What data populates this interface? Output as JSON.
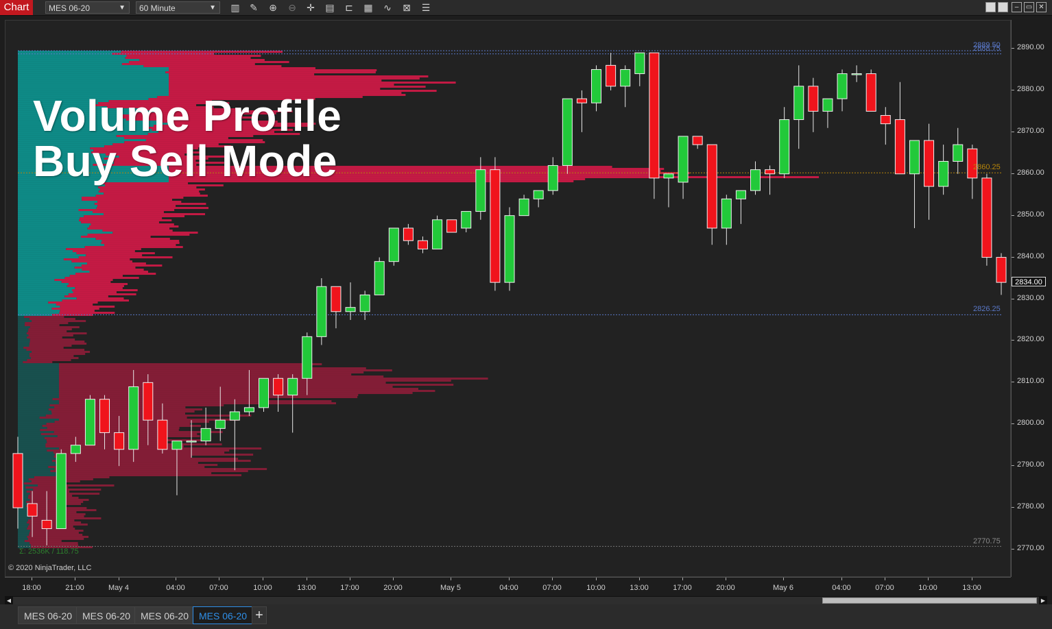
{
  "window": {
    "chart_label": "Chart",
    "instrument": "MES 06-20",
    "interval": "60 Minute"
  },
  "headline": {
    "line1": "Volume Profile",
    "line2": "Buy Sell Mode"
  },
  "copyright": "© 2020 NinjaTrader, LLC",
  "stats": "Σ: 2536K / 118.75",
  "price_axis": {
    "labels": [
      "2890.00",
      "2880.00",
      "2870.00",
      "2860.00",
      "2850.00",
      "2840.00",
      "2830.00",
      "2820.00",
      "2810.00",
      "2800.00",
      "2790.00",
      "2780.00",
      "2770.00"
    ],
    "last_price": "2834.00"
  },
  "levels": {
    "high_a": "2889.50",
    "high_b": "2888.75",
    "poc": "2860.25",
    "value_low": "2826.25",
    "low": "2770.75"
  },
  "time_axis": {
    "labels": [
      "18:00",
      "21:00",
      "May 4",
      "04:00",
      "07:00",
      "10:00",
      "13:00",
      "17:00",
      "20:00",
      "May 5",
      "04:00",
      "07:00",
      "10:00",
      "13:00",
      "17:00",
      "20:00",
      "May 6",
      "04:00",
      "07:00",
      "10:00",
      "13:00"
    ]
  },
  "tabs": [
    "MES 06-20",
    "MES 06-20",
    "MES 06-20",
    "MES 06-20"
  ],
  "active_tab": 3,
  "colors": {
    "up": "#22c93a",
    "down": "#f0141c",
    "buy_volume": "#0e8a86",
    "sell_volume": "#c41a44",
    "accent": "#2f8fe8"
  },
  "chart_data": {
    "type": "candlestick",
    "title": "",
    "xlabel": "",
    "ylabel": "",
    "ylim": [
      2766,
      2896
    ],
    "candles": [
      {
        "o": 2793,
        "h": 2797,
        "l": 2775,
        "c": 2780
      },
      {
        "o": 2781,
        "h": 2784,
        "l": 2773,
        "c": 2778
      },
      {
        "o": 2777,
        "h": 2784,
        "l": 2771,
        "c": 2775
      },
      {
        "o": 2775,
        "h": 2794,
        "l": 2775,
        "c": 2793
      },
      {
        "o": 2793,
        "h": 2797,
        "l": 2791,
        "c": 2795
      },
      {
        "o": 2795,
        "h": 2807,
        "l": 2795,
        "c": 2806
      },
      {
        "o": 2806,
        "h": 2807,
        "l": 2794,
        "c": 2798
      },
      {
        "o": 2798,
        "h": 2802,
        "l": 2790,
        "c": 2794
      },
      {
        "o": 2794,
        "h": 2813,
        "l": 2791,
        "c": 2809
      },
      {
        "o": 2810,
        "h": 2812,
        "l": 2795,
        "c": 2801
      },
      {
        "o": 2801,
        "h": 2805,
        "l": 2793,
        "c": 2794
      },
      {
        "o": 2794,
        "h": 2796,
        "l": 2783,
        "c": 2796
      },
      {
        "o": 2796,
        "h": 2801,
        "l": 2792,
        "c": 2796
      },
      {
        "o": 2796,
        "h": 2804,
        "l": 2795,
        "c": 2799
      },
      {
        "o": 2799,
        "h": 2809,
        "l": 2796,
        "c": 2801
      },
      {
        "o": 2801,
        "h": 2806,
        "l": 2789,
        "c": 2803
      },
      {
        "o": 2803,
        "h": 2813,
        "l": 2802,
        "c": 2804
      },
      {
        "o": 2804,
        "h": 2811,
        "l": 2803,
        "c": 2811
      },
      {
        "o": 2811,
        "h": 2812,
        "l": 2803,
        "c": 2807
      },
      {
        "o": 2807,
        "h": 2812,
        "l": 2798,
        "c": 2811
      },
      {
        "o": 2811,
        "h": 2822,
        "l": 2807,
        "c": 2821
      },
      {
        "o": 2821,
        "h": 2835,
        "l": 2819,
        "c": 2833
      },
      {
        "o": 2833,
        "h": 2833,
        "l": 2823,
        "c": 2827
      },
      {
        "o": 2827,
        "h": 2834,
        "l": 2825,
        "c": 2828
      },
      {
        "o": 2827,
        "h": 2832,
        "l": 2825,
        "c": 2831
      },
      {
        "o": 2831,
        "h": 2840,
        "l": 2831,
        "c": 2839
      },
      {
        "o": 2839,
        "h": 2847,
        "l": 2838,
        "c": 2847
      },
      {
        "o": 2847,
        "h": 2848,
        "l": 2843,
        "c": 2844
      },
      {
        "o": 2844,
        "h": 2845,
        "l": 2841,
        "c": 2842
      },
      {
        "o": 2842,
        "h": 2850,
        "l": 2842,
        "c": 2849
      },
      {
        "o": 2849,
        "h": 2849,
        "l": 2846,
        "c": 2846
      },
      {
        "o": 2847,
        "h": 2851,
        "l": 2846,
        "c": 2851
      },
      {
        "o": 2851,
        "h": 2864,
        "l": 2849,
        "c": 2861
      },
      {
        "o": 2861,
        "h": 2864,
        "l": 2832,
        "c": 2834
      },
      {
        "o": 2834,
        "h": 2852,
        "l": 2832,
        "c": 2850
      },
      {
        "o": 2850,
        "h": 2855,
        "l": 2850,
        "c": 2854
      },
      {
        "o": 2854,
        "h": 2856,
        "l": 2852,
        "c": 2856
      },
      {
        "o": 2856,
        "h": 2864,
        "l": 2855,
        "c": 2862
      },
      {
        "o": 2862,
        "h": 2878,
        "l": 2860,
        "c": 2878
      },
      {
        "o": 2878,
        "h": 2880,
        "l": 2870,
        "c": 2877
      },
      {
        "o": 2877,
        "h": 2886,
        "l": 2875,
        "c": 2885
      },
      {
        "o": 2886,
        "h": 2889,
        "l": 2880,
        "c": 2881
      },
      {
        "o": 2881,
        "h": 2886,
        "l": 2876,
        "c": 2885
      },
      {
        "o": 2884,
        "h": 2889,
        "l": 2881,
        "c": 2889
      },
      {
        "o": 2889,
        "h": 2889,
        "l": 2854,
        "c": 2859
      },
      {
        "o": 2859,
        "h": 2860,
        "l": 2852,
        "c": 2860
      },
      {
        "o": 2858,
        "h": 2869,
        "l": 2854,
        "c": 2869
      },
      {
        "o": 2869,
        "h": 2869,
        "l": 2866,
        "c": 2867
      },
      {
        "o": 2867,
        "h": 2867,
        "l": 2843,
        "c": 2847
      },
      {
        "o": 2847,
        "h": 2855,
        "l": 2843,
        "c": 2854
      },
      {
        "o": 2854,
        "h": 2856,
        "l": 2848,
        "c": 2856
      },
      {
        "o": 2856,
        "h": 2863,
        "l": 2855,
        "c": 2861
      },
      {
        "o": 2861,
        "h": 2862,
        "l": 2855,
        "c": 2860
      },
      {
        "o": 2860,
        "h": 2876,
        "l": 2859,
        "c": 2873
      },
      {
        "o": 2873,
        "h": 2886,
        "l": 2866,
        "c": 2881
      },
      {
        "o": 2881,
        "h": 2883,
        "l": 2870,
        "c": 2875
      },
      {
        "o": 2875,
        "h": 2878,
        "l": 2871,
        "c": 2878
      },
      {
        "o": 2878,
        "h": 2885,
        "l": 2875,
        "c": 2884
      },
      {
        "o": 2884,
        "h": 2886,
        "l": 2882,
        "c": 2884
      },
      {
        "o": 2884,
        "h": 2885,
        "l": 2875,
        "c": 2875
      },
      {
        "o": 2874,
        "h": 2876,
        "l": 2867,
        "c": 2872
      },
      {
        "o": 2873,
        "h": 2882,
        "l": 2864,
        "c": 2860
      },
      {
        "o": 2860,
        "h": 2868,
        "l": 2847,
        "c": 2868
      },
      {
        "o": 2868,
        "h": 2872,
        "l": 2849,
        "c": 2857
      },
      {
        "o": 2857,
        "h": 2867,
        "l": 2855,
        "c": 2863
      },
      {
        "o": 2863,
        "h": 2871,
        "l": 2860,
        "c": 2867
      },
      {
        "o": 2866,
        "h": 2867,
        "l": 2854,
        "c": 2859
      },
      {
        "o": 2859,
        "h": 2860,
        "l": 2838,
        "c": 2840
      },
      {
        "o": 2840,
        "h": 2841,
        "l": 2831,
        "c": 2834
      }
    ]
  }
}
